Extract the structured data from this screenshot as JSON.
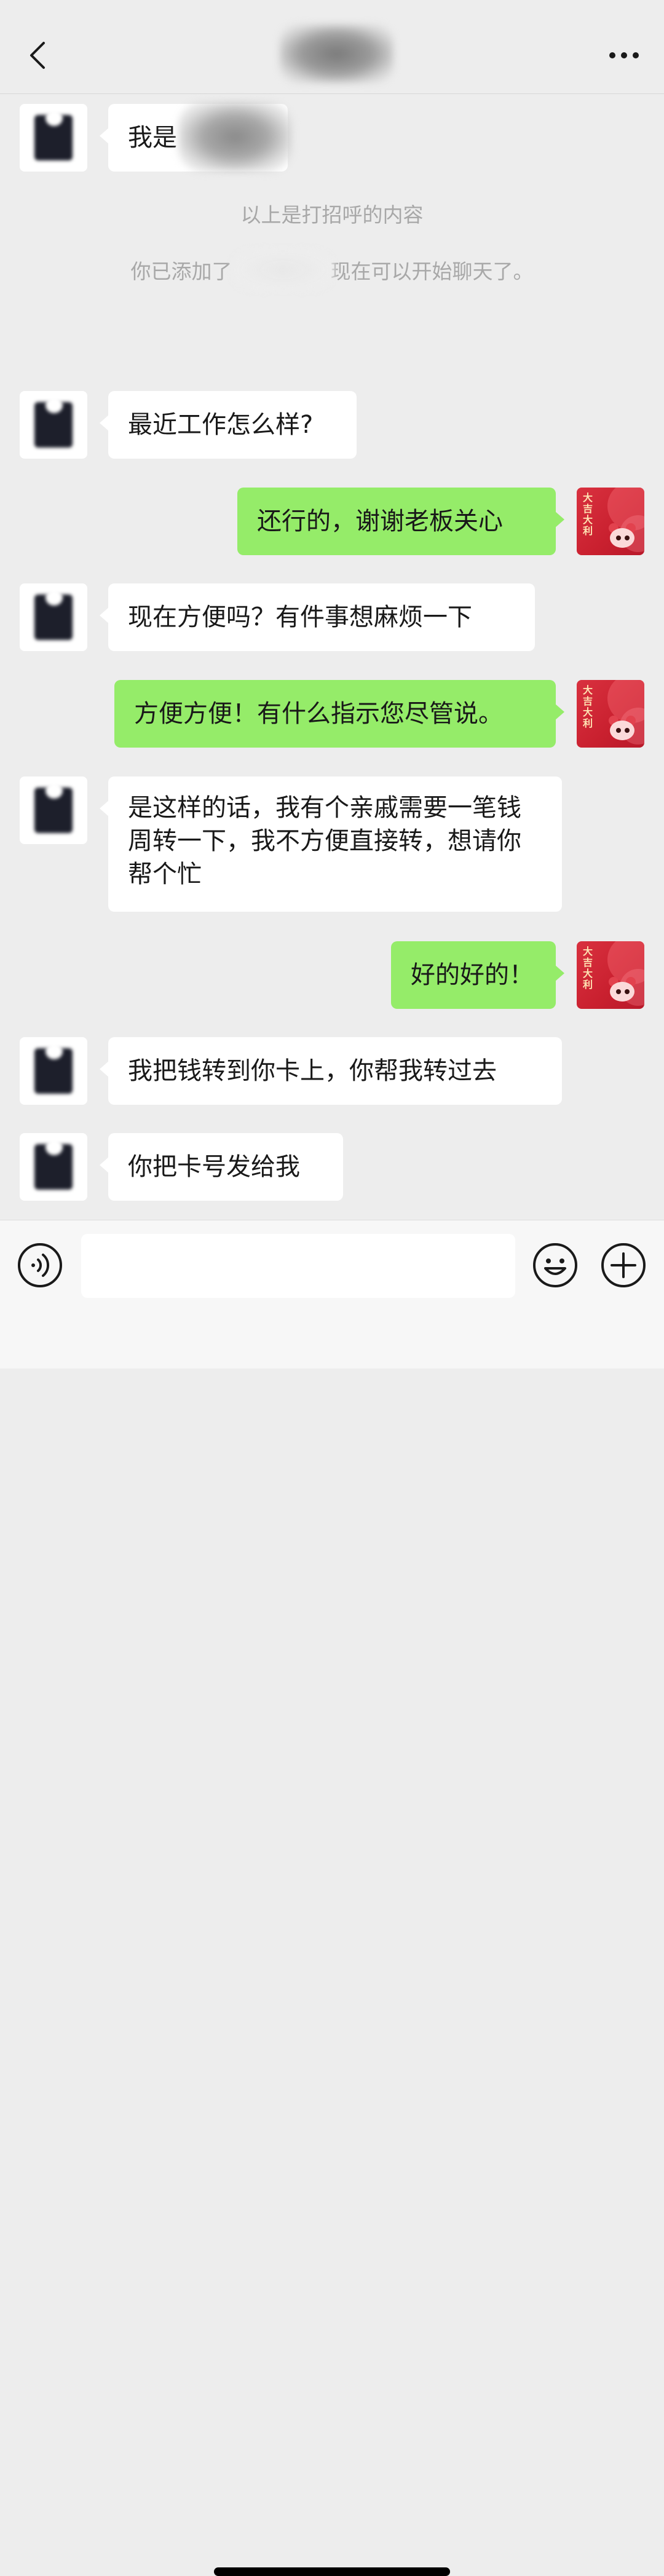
{
  "header": {
    "back_icon": "chevron-left-icon",
    "more_icon": "ellipsis-icon"
  },
  "messages": {
    "m1": "我是",
    "system_greeting": "以上是打招呼的内容",
    "system_added_prefix": "你已添加了",
    "system_added_suffix": "现在可以开始聊天了。",
    "m2": "最近工作怎么样?",
    "m3": "还行的，谢谢老板关心",
    "m4": "现在方便吗？有件事想麻烦一下",
    "m5": "方便方便！有什么指示您尽管说。",
    "m6": "是这样的话，我有个亲戚需要一笔钱周转一下，我不方便直接转，想请你帮个忙",
    "m7": "好的好的！",
    "m8": "我把钱转到你卡上，你帮我转过去",
    "m9": "你把卡号发给我"
  },
  "self_avatar_text": "大吉大利",
  "input_bar": {
    "input_value": "",
    "voice_icon": "voice-icon",
    "emoji_icon": "emoji-icon",
    "plus_icon": "plus-icon"
  },
  "colors": {
    "background": "#ededed",
    "incoming_bubble": "#ffffff",
    "outgoing_bubble": "#95ec69",
    "system_text": "#a8a8a8"
  }
}
